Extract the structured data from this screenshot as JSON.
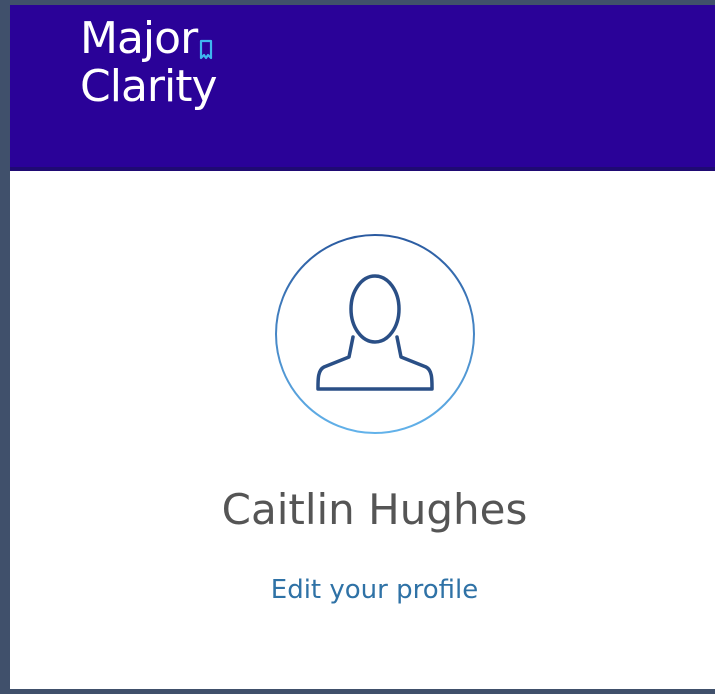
{
  "header": {
    "logo_line1": "Major",
    "logo_line2": "Clarity",
    "background_color": "#2a0298",
    "logo_accent_color": "#3fb6ef"
  },
  "profile": {
    "avatar_icon": "user-icon",
    "name": "Caitlin Hughes",
    "edit_link": "Edit your profile"
  }
}
